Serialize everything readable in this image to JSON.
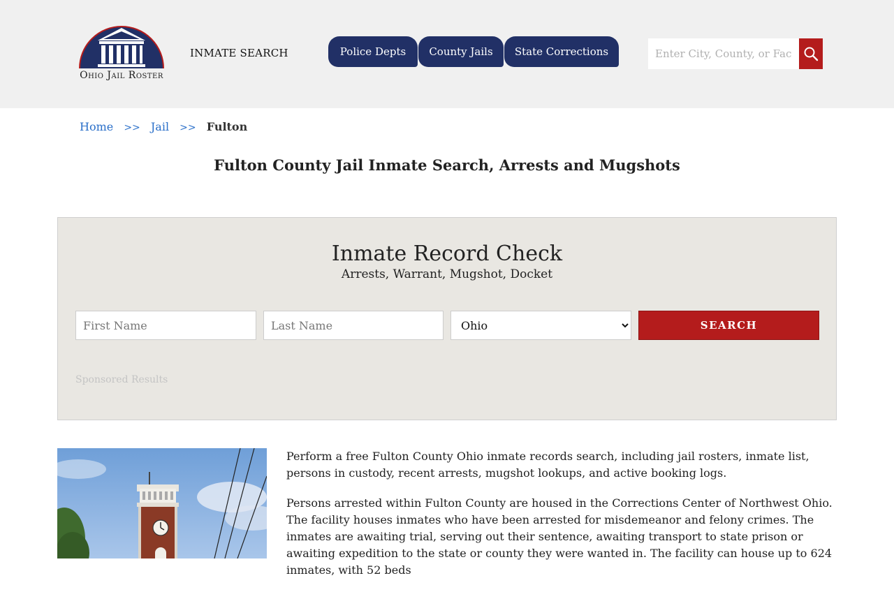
{
  "header": {
    "logo_text": "Ohio Jail Roster",
    "inmate_search_label": "INMATE SEARCH",
    "nav": [
      {
        "label": "Police Depts"
      },
      {
        "label": "County Jails"
      },
      {
        "label": "State Corrections"
      }
    ],
    "search": {
      "placeholder": "Enter City, County, or Facility",
      "icon": "search-icon"
    }
  },
  "breadcrumb": {
    "items": [
      {
        "label": "Home"
      },
      {
        "label": "Jail"
      }
    ],
    "separator": ">>",
    "current": "Fulton"
  },
  "page_title": "Fulton County Jail Inmate Search, Arrests and Mugshots",
  "record_check": {
    "title": "Inmate Record Check",
    "subtitle": "Arrests, Warrant, Mugshot, Docket",
    "first_name_placeholder": "First Name",
    "last_name_placeholder": "Last Name",
    "state_selected": "Ohio",
    "search_label": "SEARCH",
    "sponsored_label": "Sponsored Results"
  },
  "content": {
    "paragraphs": [
      "Perform a free Fulton County Ohio inmate records search, including jail rosters, inmate list, persons in custody, recent arrests, mugshot lookups, and active booking logs.",
      "Persons arrested within Fulton County are housed in the Corrections Center of Northwest Ohio. The facility houses inmates who have been arrested for misdemeanor and felony crimes. The inmates are awaiting trial, serving out their sentence, awaiting transport to state prison or awaiting expedition to the state or county they were wanted in. The facility can house up to 624 inmates, with 52 beds"
    ]
  },
  "colors": {
    "header_bg": "#f0f0f0",
    "nav_bg": "#213066",
    "accent_red": "#b41c1c",
    "link_blue": "#2a6fc9",
    "panel_bg": "#e9e7e2"
  }
}
